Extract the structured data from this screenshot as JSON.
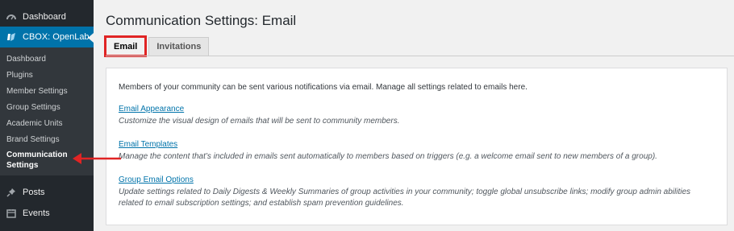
{
  "sidebar": {
    "dashboard_label": "Dashboard",
    "current_label": "CBOX: OpenLab",
    "submenu": [
      "Dashboard",
      "Plugins",
      "Member Settings",
      "Group Settings",
      "Academic Units",
      "Brand Settings"
    ],
    "active_sub_line1": "Communication",
    "active_sub_line2": "Settings",
    "posts_label": "Posts",
    "events_label": "Events"
  },
  "page": {
    "title": "Communication Settings: Email",
    "tabs": [
      "Email",
      "Invitations"
    ],
    "intro": "Members of your community can be sent various notifications via email. Manage all settings related to emails here.",
    "sections": [
      {
        "link": "Email Appearance",
        "desc": "Customize the visual design of emails that will be sent to community members."
      },
      {
        "link": "Email Templates",
        "desc": "Manage the content that’s included in emails sent automatically to members based on triggers (e.g. a welcome email sent to new members of a group)."
      },
      {
        "link": "Group Email Options",
        "desc": "Update settings related to Daily Digests & Weekly Summaries of group activities in your community; toggle global unsubscribe links; modify group admin abilities related to email subscription settings; and establish spam prevention guidelines."
      }
    ]
  },
  "colors": {
    "sidebar_bg": "#23282d",
    "accent": "#0073aa",
    "highlight": "#e02424"
  },
  "icons": [
    "dashboard-icon",
    "cbox-icon",
    "pin-icon",
    "calendar-icon",
    "red-arrow-icon"
  ]
}
